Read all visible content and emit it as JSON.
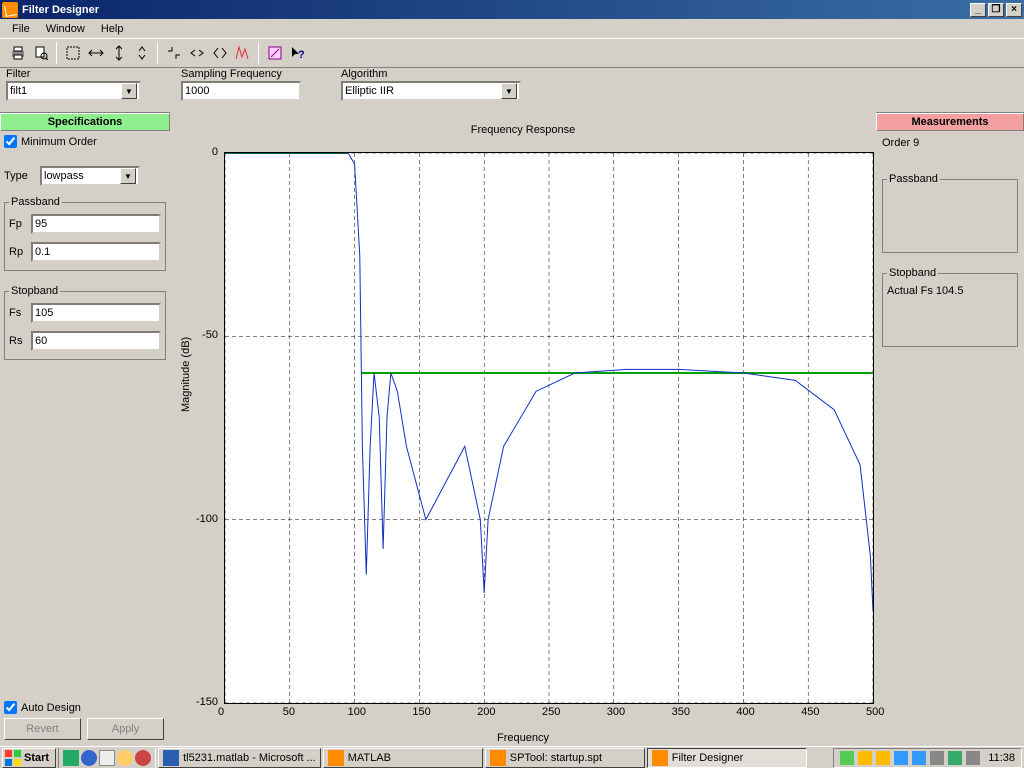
{
  "titlebar": {
    "title": "Filter Designer"
  },
  "menu": {
    "file": "File",
    "window": "Window",
    "help": "Help"
  },
  "form": {
    "filter_label": "Filter",
    "filter_value": "filt1",
    "fs_label": "Sampling Frequency",
    "fs_value": "1000",
    "algo_label": "Algorithm",
    "algo_value": "Elliptic IIR"
  },
  "left": {
    "header": "Specifications",
    "min_order": "Minimum Order",
    "type_label": "Type",
    "type_value": "lowpass",
    "passband_legend": "Passband",
    "fp_label": "Fp",
    "fp_value": "95",
    "rp_label": "Rp",
    "rp_value": "0.1",
    "stopband_legend": "Stopband",
    "fstop_label": "Fs",
    "fstop_value": "105",
    "rs_label": "Rs",
    "rs_value": "60",
    "auto_design": "Auto Design",
    "revert": "Revert",
    "apply": "Apply"
  },
  "right": {
    "header": "Measurements",
    "order": "Order 9",
    "passband_legend": "Passband",
    "stopband_legend": "Stopband",
    "actual_fs": "Actual Fs  104.5"
  },
  "chart_data": {
    "type": "line",
    "title": "Frequency Response",
    "xlabel": "Frequency",
    "ylabel": "Magnitude (dB)",
    "xlim": [
      0,
      500
    ],
    "ylim": [
      -150,
      0
    ],
    "xticks": [
      0,
      50,
      100,
      150,
      200,
      250,
      300,
      350,
      400,
      450,
      500
    ],
    "yticks": [
      0,
      -50,
      -100,
      -150
    ],
    "series": [
      {
        "name": "passband-constraint",
        "color": "#00a000",
        "width": 2,
        "x": [
          0,
          95
        ],
        "values": [
          0,
          0
        ]
      },
      {
        "name": "stopband-constraint",
        "color": "#00a000",
        "width": 2,
        "x": [
          105,
          500
        ],
        "values": [
          -60,
          -60
        ]
      },
      {
        "name": "response",
        "color": "#1030c0",
        "width": 1,
        "x": [
          0,
          60,
          90,
          95,
          100,
          104,
          106,
          109,
          112,
          115,
          119,
          122,
          125,
          128,
          133,
          140,
          155,
          170,
          185,
          197,
          200,
          203,
          215,
          240,
          270,
          310,
          350,
          400,
          440,
          470,
          490,
          498,
          500
        ],
        "values": [
          0,
          0,
          0,
          0,
          -3,
          -28,
          -80,
          -115,
          -80,
          -60,
          -72,
          -108,
          -72,
          -60,
          -65,
          -80,
          -100,
          -90,
          -80,
          -100,
          -120,
          -100,
          -80,
          -65,
          -60,
          -59,
          -59,
          -60,
          -62,
          -70,
          -85,
          -110,
          -125
        ]
      }
    ]
  },
  "taskbar": {
    "start": "Start",
    "items": [
      {
        "label": "tl5231.matlab - Microsoft ..."
      },
      {
        "label": "MATLAB"
      },
      {
        "label": "SPTool: startup.spt"
      },
      {
        "label": "Filter Designer"
      }
    ],
    "clock": "11:38"
  }
}
